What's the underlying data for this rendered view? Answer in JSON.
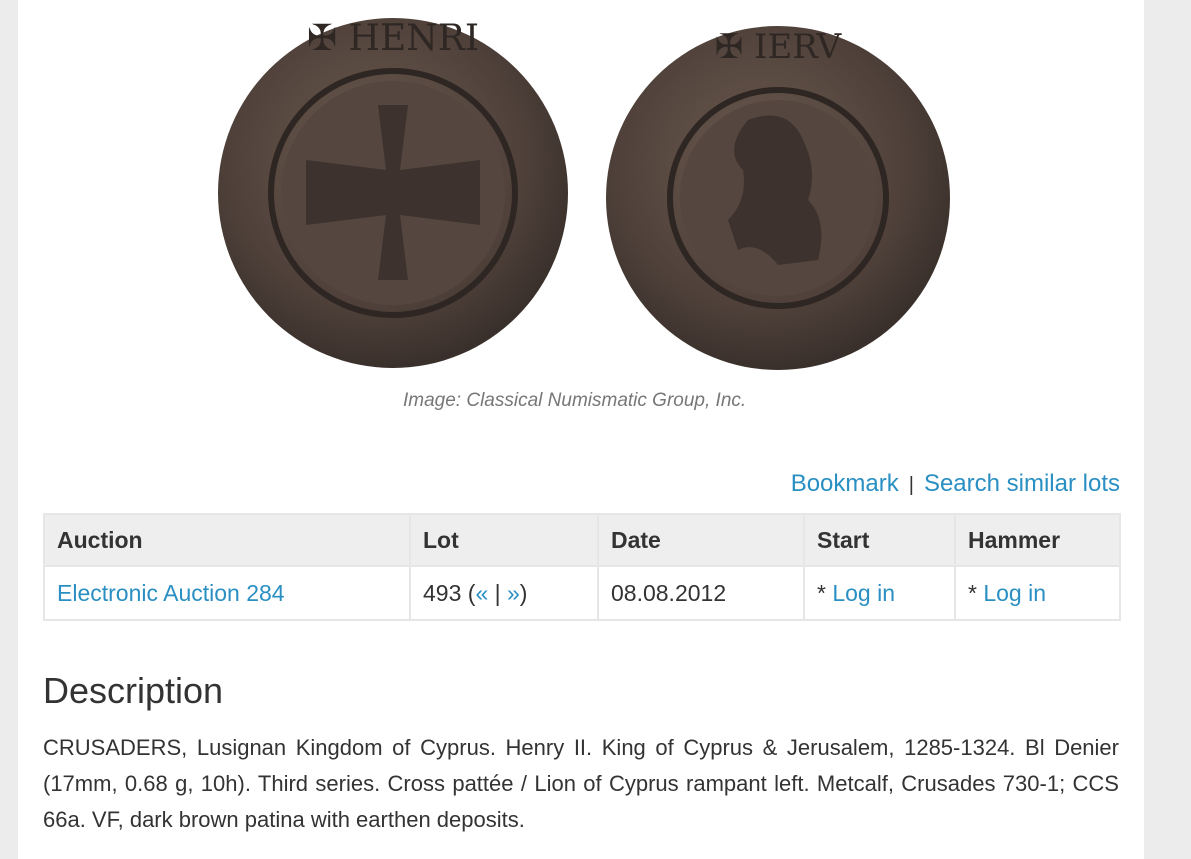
{
  "image": {
    "credit": "Image: Classical Numismatic Group, Inc."
  },
  "actions": {
    "bookmark": "Bookmark",
    "separator": "|",
    "search_similar": "Search similar lots"
  },
  "table": {
    "headers": [
      "Auction",
      "Lot",
      "Date",
      "Start",
      "Hammer"
    ],
    "row": {
      "auction": "Electronic Auction 284",
      "lot_number": "493",
      "lot_prev": "«",
      "lot_sep": "|",
      "lot_next": "»",
      "date": "08.08.2012",
      "start_prefix": "*",
      "start_login": "Log in",
      "hammer_prefix": "*",
      "hammer_login": "Log in"
    }
  },
  "description": {
    "title": "Description",
    "text": "CRUSADERS, Lusignan Kingdom of Cyprus. Henry II. King of Cyprus & Jerusalem, 1285-1324. Bl Denier (17mm, 0.68 g, 10h). Third series. Cross pattée / Lion of Cyprus rampant left. Metcalf, Crusades 730-1; CCS 66a. VF, dark brown patina with earthen deposits."
  },
  "colors": {
    "link": "#2a8fc2",
    "background": "#ececec",
    "panel": "#ffffff",
    "coin": "#5a4a42"
  }
}
